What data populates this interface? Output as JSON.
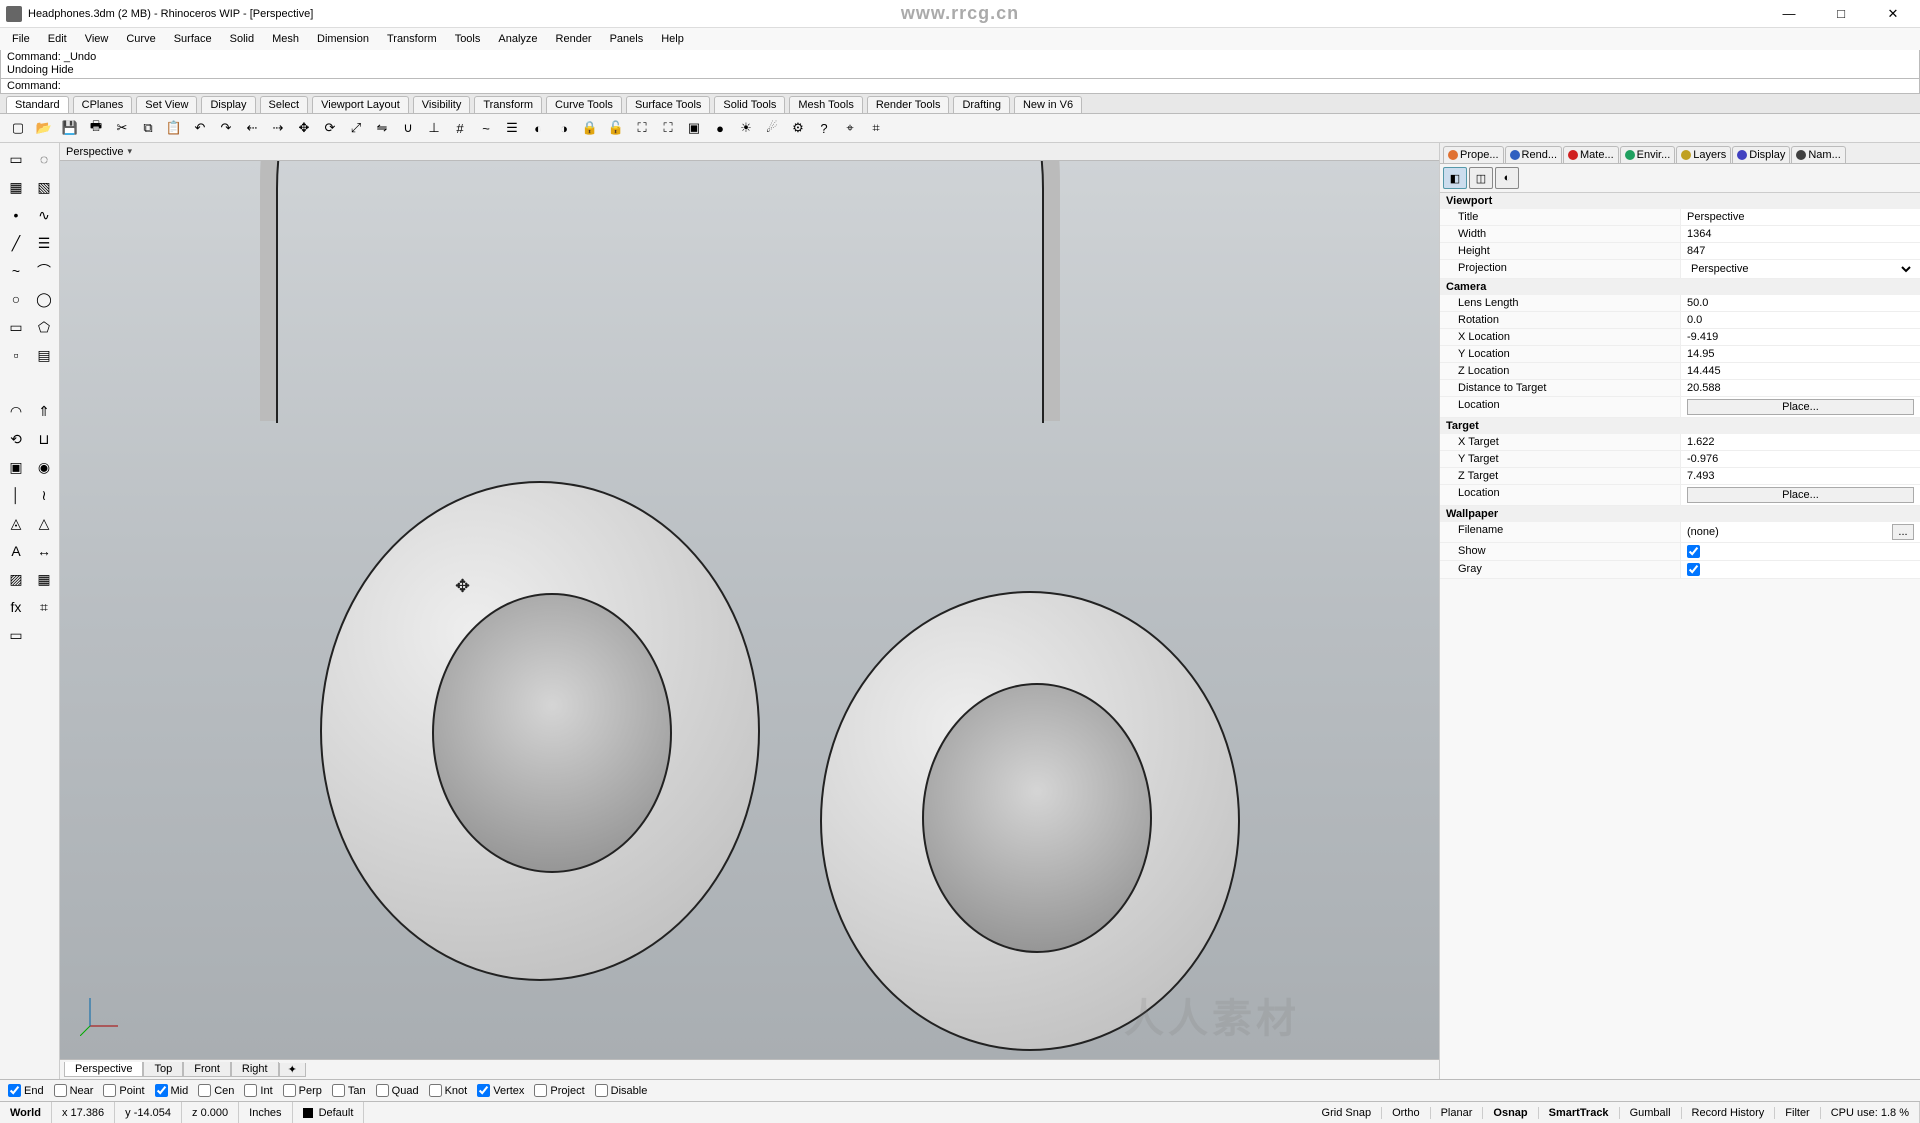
{
  "window": {
    "title": "Headphones.3dm (2 MB) - Rhinoceros WIP - [Perspective]",
    "watermark_url": "www.rrcg.cn",
    "watermark_big": "人人素材"
  },
  "menus": [
    "File",
    "Edit",
    "View",
    "Curve",
    "Surface",
    "Solid",
    "Mesh",
    "Dimension",
    "Transform",
    "Tools",
    "Analyze",
    "Render",
    "Panels",
    "Help"
  ],
  "command_history": [
    "Command: _Undo",
    "Undoing Hide"
  ],
  "command_prompt": "Command:",
  "command_input": "",
  "toolbar_tabs": [
    "Standard",
    "CPlanes",
    "Set View",
    "Display",
    "Select",
    "Viewport Layout",
    "Visibility",
    "Transform",
    "Curve Tools",
    "Surface Tools",
    "Solid Tools",
    "Mesh Tools",
    "Render Tools",
    "Drafting",
    "New in V6"
  ],
  "viewport": {
    "title_tab": "Perspective"
  },
  "viewport_bottom_tabs": [
    "Perspective",
    "Top",
    "Front",
    "Right"
  ],
  "right_tabs": [
    {
      "label": "Prope...",
      "color": "#e07030"
    },
    {
      "label": "Rend...",
      "color": "#3060c0"
    },
    {
      "label": "Mate...",
      "color": "#d02020"
    },
    {
      "label": "Envir...",
      "color": "#20a060"
    },
    {
      "label": "Layers",
      "color": "#c0a020"
    },
    {
      "label": "Display",
      "color": "#4040c0"
    },
    {
      "label": "Nam...",
      "color": "#404040"
    }
  ],
  "properties": {
    "sections": [
      {
        "title": "Viewport",
        "rows": [
          {
            "label": "Title",
            "value": "Perspective",
            "type": "text"
          },
          {
            "label": "Width",
            "value": "1364",
            "type": "text"
          },
          {
            "label": "Height",
            "value": "847",
            "type": "text"
          },
          {
            "label": "Projection",
            "value": "Perspective",
            "type": "select"
          }
        ]
      },
      {
        "title": "Camera",
        "rows": [
          {
            "label": "Lens Length",
            "value": "50.0",
            "type": "text"
          },
          {
            "label": "Rotation",
            "value": "0.0",
            "type": "text"
          },
          {
            "label": "X Location",
            "value": "-9.419",
            "type": "text"
          },
          {
            "label": "Y Location",
            "value": "14.95",
            "type": "text"
          },
          {
            "label": "Z Location",
            "value": "14.445",
            "type": "text"
          },
          {
            "label": "Distance to Target",
            "value": "20.588",
            "type": "text"
          },
          {
            "label": "Location",
            "value": "Place...",
            "type": "button"
          }
        ]
      },
      {
        "title": "Target",
        "rows": [
          {
            "label": "X Target",
            "value": "1.622",
            "type": "text"
          },
          {
            "label": "Y Target",
            "value": "-0.976",
            "type": "text"
          },
          {
            "label": "Z Target",
            "value": "7.493",
            "type": "text"
          },
          {
            "label": "Location",
            "value": "Place...",
            "type": "button"
          }
        ]
      },
      {
        "title": "Wallpaper",
        "rows": [
          {
            "label": "Filename",
            "value": "(none)",
            "type": "browse"
          },
          {
            "label": "Show",
            "value": "true",
            "type": "check"
          },
          {
            "label": "Gray",
            "value": "true",
            "type": "check"
          }
        ]
      }
    ]
  },
  "osnaps": [
    {
      "label": "End",
      "checked": true
    },
    {
      "label": "Near",
      "checked": false
    },
    {
      "label": "Point",
      "checked": false
    },
    {
      "label": "Mid",
      "checked": true
    },
    {
      "label": "Cen",
      "checked": false
    },
    {
      "label": "Int",
      "checked": false
    },
    {
      "label": "Perp",
      "checked": false
    },
    {
      "label": "Tan",
      "checked": false
    },
    {
      "label": "Quad",
      "checked": false
    },
    {
      "label": "Knot",
      "checked": false
    },
    {
      "label": "Vertex",
      "checked": true
    },
    {
      "label": "Project",
      "checked": false
    },
    {
      "label": "Disable",
      "checked": false
    }
  ],
  "statusbar": {
    "cplane": "World",
    "x": "x 17.386",
    "y": "y -14.054",
    "z": "z 0.000",
    "units": "Inches",
    "layer": "Default",
    "toggles": [
      "Grid Snap",
      "Ortho",
      "Planar",
      "Osnap",
      "SmartTrack",
      "Gumball",
      "Record History",
      "Filter"
    ],
    "active_toggles": [
      "Osnap",
      "SmartTrack"
    ],
    "cpu": "CPU use: 1.8 %"
  },
  "htool_icons": [
    "new",
    "open",
    "save",
    "print",
    "cut",
    "copy",
    "paste",
    "undo",
    "redo",
    "ptA",
    "ptB",
    "move",
    "rot",
    "scale",
    "mirror",
    "join",
    "adj",
    "snap",
    "rebuild",
    "layer",
    "hide",
    "show",
    "lock",
    "unlock",
    "group",
    "ungroup",
    "cube",
    "sphere",
    "render",
    "raytrace",
    "opts",
    "help",
    "osn1",
    "osn2"
  ],
  "vtool_icons": [
    "select",
    "lasso",
    "cplane",
    "cplane2",
    "sel-pt",
    "sel-crv",
    "pt",
    "pts",
    "line",
    "poly",
    "curve",
    "arc",
    "circle",
    "ellipse",
    "rect",
    "polygon",
    "sep",
    "srf",
    "loft",
    "ext",
    "rev",
    "bool",
    "box",
    "sphere",
    "pipe",
    "sweep",
    "mesh",
    "subd",
    "text",
    "dim",
    "hatch",
    "block",
    "grid",
    "calc"
  ]
}
